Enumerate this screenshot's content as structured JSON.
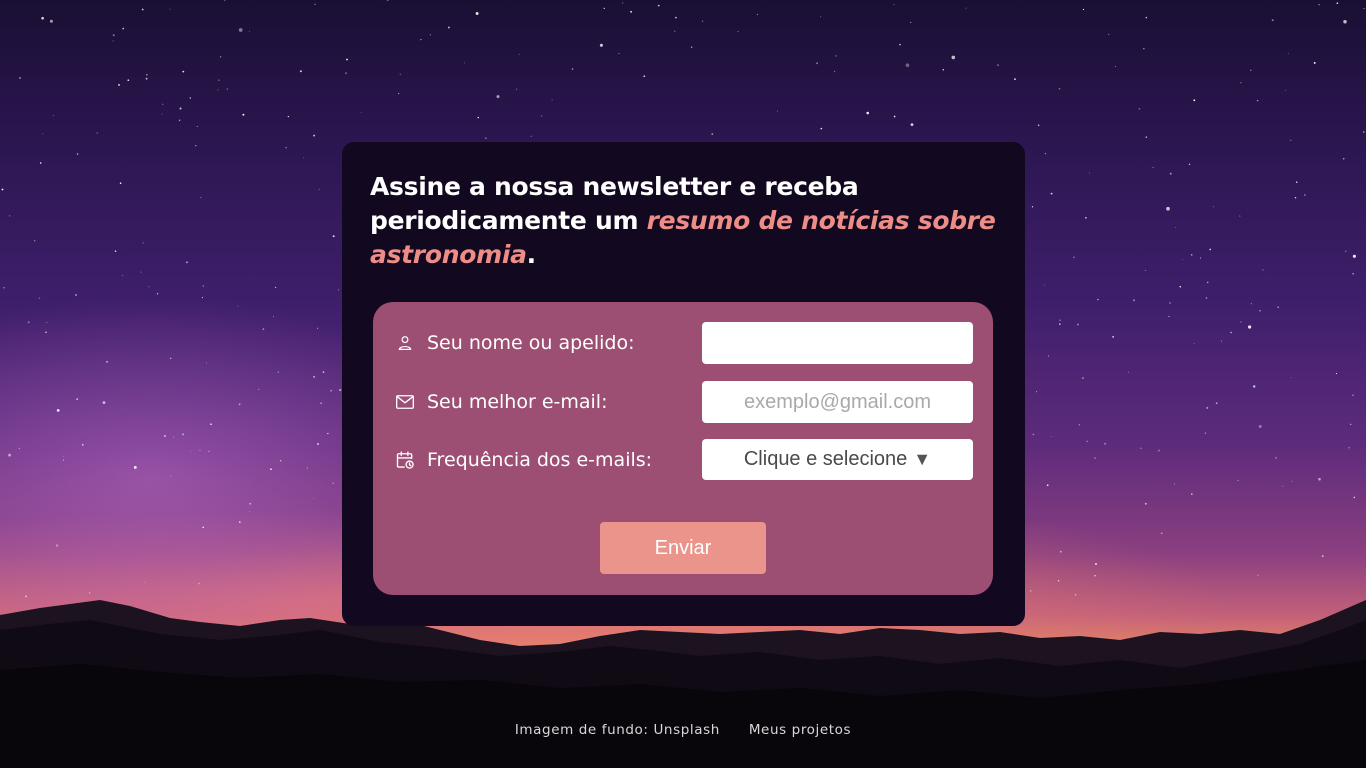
{
  "headline": {
    "text_before": "Assine a nossa newsletter e receba periodicamente um ",
    "accent": "resumo de notícias sobre astronomia",
    "text_after": "."
  },
  "form": {
    "name": {
      "icon": "person-icon",
      "label": "Seu nome ou apelido:",
      "value": "",
      "placeholder": ""
    },
    "email": {
      "icon": "envelope-icon",
      "label": "Seu melhor e-mail:",
      "value": "",
      "placeholder": "exemplo@gmail.com"
    },
    "frequency": {
      "icon": "calendar-clock-icon",
      "label": "Frequência dos e-mails:",
      "selected": "Clique e selecione",
      "caret": "▼"
    },
    "submit_label": "Enviar"
  },
  "footer": {
    "links": [
      {
        "label": "Imagem de fundo: Unsplash"
      },
      {
        "label": "Meus projetos"
      }
    ]
  },
  "colors": {
    "card_background": "#120820",
    "form_background": "#9c4f72",
    "accent": "#ee8c88",
    "button": "#ea948b"
  }
}
